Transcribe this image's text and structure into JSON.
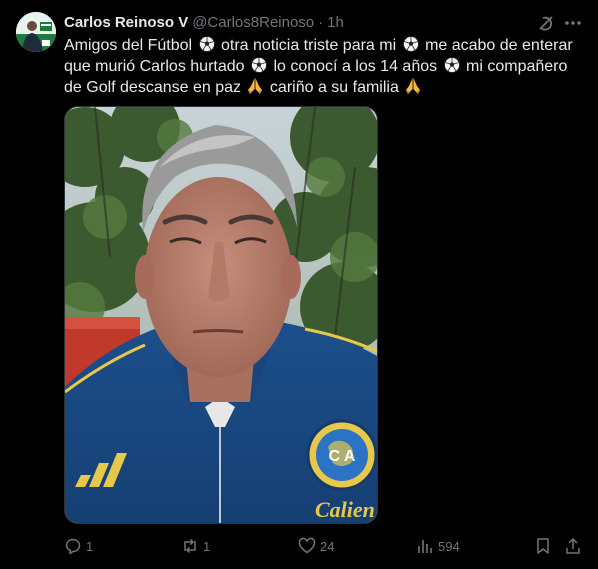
{
  "author": {
    "name": "Carlos Reinoso V",
    "handle": "@Carlos8Reinoso",
    "separator": "·",
    "time": "1h"
  },
  "tweet": {
    "segments": [
      "Amigos del Fútbol",
      "otra noticia  triste para mi",
      "me acabo de enterar que murió Carlos hurtado",
      "lo conocí a los 14 años",
      "mi compañero de Golf descanse en paz",
      "cariño a su familia"
    ]
  },
  "media": {
    "badge_text": "C A",
    "shirt_text": "Calien"
  },
  "actions": {
    "replies": "1",
    "reposts": "1",
    "likes": "24",
    "views": "594"
  },
  "icons": [
    "grok-icon",
    "more-icon",
    "soccer-ball-icon",
    "folded-hands-icon",
    "reply-icon",
    "repost-icon",
    "like-icon",
    "views-icon",
    "bookmark-icon",
    "share-icon"
  ],
  "colors": {
    "background": "#000000",
    "text": "#e7e9ea",
    "muted": "#71767b",
    "border": "#2f3336"
  }
}
